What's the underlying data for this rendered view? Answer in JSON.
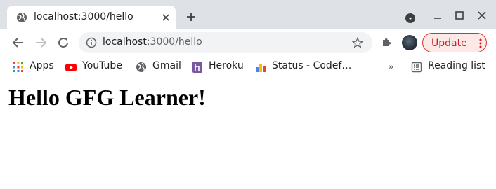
{
  "tab": {
    "title": "localhost:3000/hello"
  },
  "omnibox": {
    "host": "localhost",
    "path": ":3000/hello"
  },
  "toolbar": {
    "update_label": "Update"
  },
  "bookmarks": {
    "items": [
      {
        "label": "Apps",
        "icon": "apps-grid-icon"
      },
      {
        "label": "YouTube",
        "icon": "youtube-icon"
      },
      {
        "label": "Gmail",
        "icon": "globe-icon"
      },
      {
        "label": "Heroku",
        "icon": "heroku-icon"
      },
      {
        "label": "Status - Codef…",
        "icon": "bar-chart-icon"
      }
    ],
    "more": "»",
    "reading_list": "Reading list"
  },
  "page": {
    "heading": "Hello GFG Learner!"
  },
  "colors": {
    "tabstrip_bg": "#dee1e6",
    "update_accent": "#d93025",
    "heroku_purple": "#79589f",
    "youtube_red": "#ff0000"
  }
}
